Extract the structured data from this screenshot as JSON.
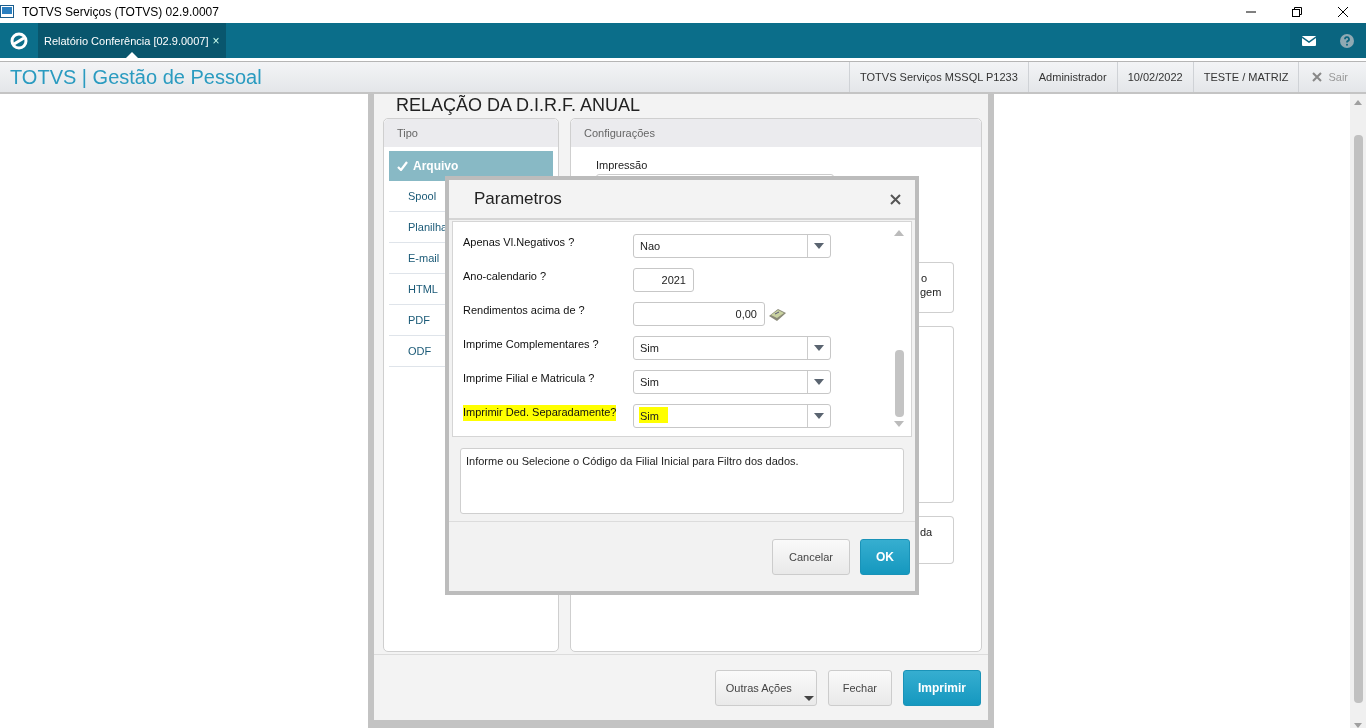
{
  "window": {
    "title": "TOTVS Serviços (TOTVS) 02.9.0007"
  },
  "tabs": [
    {
      "label": "Relatório Conferência [02.9.0007]",
      "close": "×",
      "selected": true
    }
  ],
  "header": {
    "app_title": "TOTVS | Gestão de Pessoal",
    "info": [
      "TOTVS Serviços MSSQL P1233",
      "Administrador",
      "10/02/2022",
      "TESTE / MATRIZ"
    ],
    "exit": {
      "label": "Sair",
      "disabled": true
    }
  },
  "report_dialog": {
    "title": "RELAÇÃO DA D.I.R.F. ANUAL",
    "tipo": {
      "heading": "Tipo",
      "items": [
        {
          "label": "Arquivo",
          "selected": true
        },
        {
          "label": "Spool",
          "selected": false
        },
        {
          "label": "Planilha",
          "selected": false
        },
        {
          "label": "E-mail",
          "selected": false
        },
        {
          "label": "HTML",
          "selected": false
        },
        {
          "label": "PDF",
          "selected": false
        },
        {
          "label": "ODF",
          "selected": false
        }
      ]
    },
    "config": {
      "heading": "Configurações",
      "print_label": "Impressão",
      "option_fragments": [
        [
          "o",
          "gem"
        ],
        [
          "da"
        ]
      ]
    },
    "buttons": [
      {
        "label": "Outras Ações",
        "kind": "menu"
      },
      {
        "label": "Fechar",
        "kind": "default"
      },
      {
        "label": "Imprimir",
        "kind": "primary"
      }
    ]
  },
  "parameters_dialog": {
    "title": "Parametros",
    "rows": [
      {
        "label": "Apenas Vl.Negativos ?",
        "kind": "select",
        "value": "Nao",
        "highlighted": false
      },
      {
        "label": "Ano-calendario ?",
        "kind": "number",
        "value": "2021",
        "highlighted": false
      },
      {
        "label": "Rendimentos acima de ?",
        "kind": "currency",
        "value": "0,00",
        "highlighted": false
      },
      {
        "label": "Imprime Complementares ?",
        "kind": "select",
        "value": "Sim",
        "highlighted": false
      },
      {
        "label": "Imprime Filial e Matricula ?",
        "kind": "select",
        "value": "Sim",
        "highlighted": false
      },
      {
        "label": "Imprimir Ded. Separadamente?",
        "kind": "select",
        "value": "Sim",
        "highlighted": true
      }
    ],
    "help_text": "Informe ou Selecione o Código da Filial Inicial para Filtro dos dados.",
    "buttons": [
      {
        "label": "Cancelar",
        "kind": "default"
      },
      {
        "label": "OK",
        "kind": "primary"
      }
    ]
  }
}
